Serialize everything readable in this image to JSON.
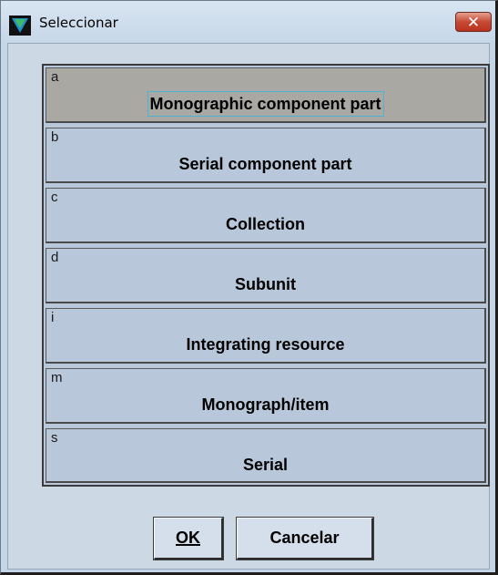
{
  "window": {
    "title": "Seleccionar",
    "close_glyph": "✕"
  },
  "options": [
    {
      "code": "a",
      "label": "Monographic component part",
      "selected": true
    },
    {
      "code": "b",
      "label": "Serial component part",
      "selected": false
    },
    {
      "code": "c",
      "label": "Collection",
      "selected": false
    },
    {
      "code": "d",
      "label": "Subunit",
      "selected": false
    },
    {
      "code": "i",
      "label": "Integrating resource",
      "selected": false
    },
    {
      "code": "m",
      "label": "Monograph/item",
      "selected": false
    },
    {
      "code": "s",
      "label": "Serial",
      "selected": false
    }
  ],
  "buttons": {
    "ok_label": "OK",
    "cancel_label": "Cancelar"
  },
  "icons": {
    "app": "app-logo-icon",
    "close": "close-icon"
  },
  "colors": {
    "window_bg": "#c4d5e6",
    "option_bg": "#b8c7d9",
    "selected_bg": "#a9a8a3",
    "focus_ring": "#4fb0d8",
    "close_button": "#c64a36"
  }
}
